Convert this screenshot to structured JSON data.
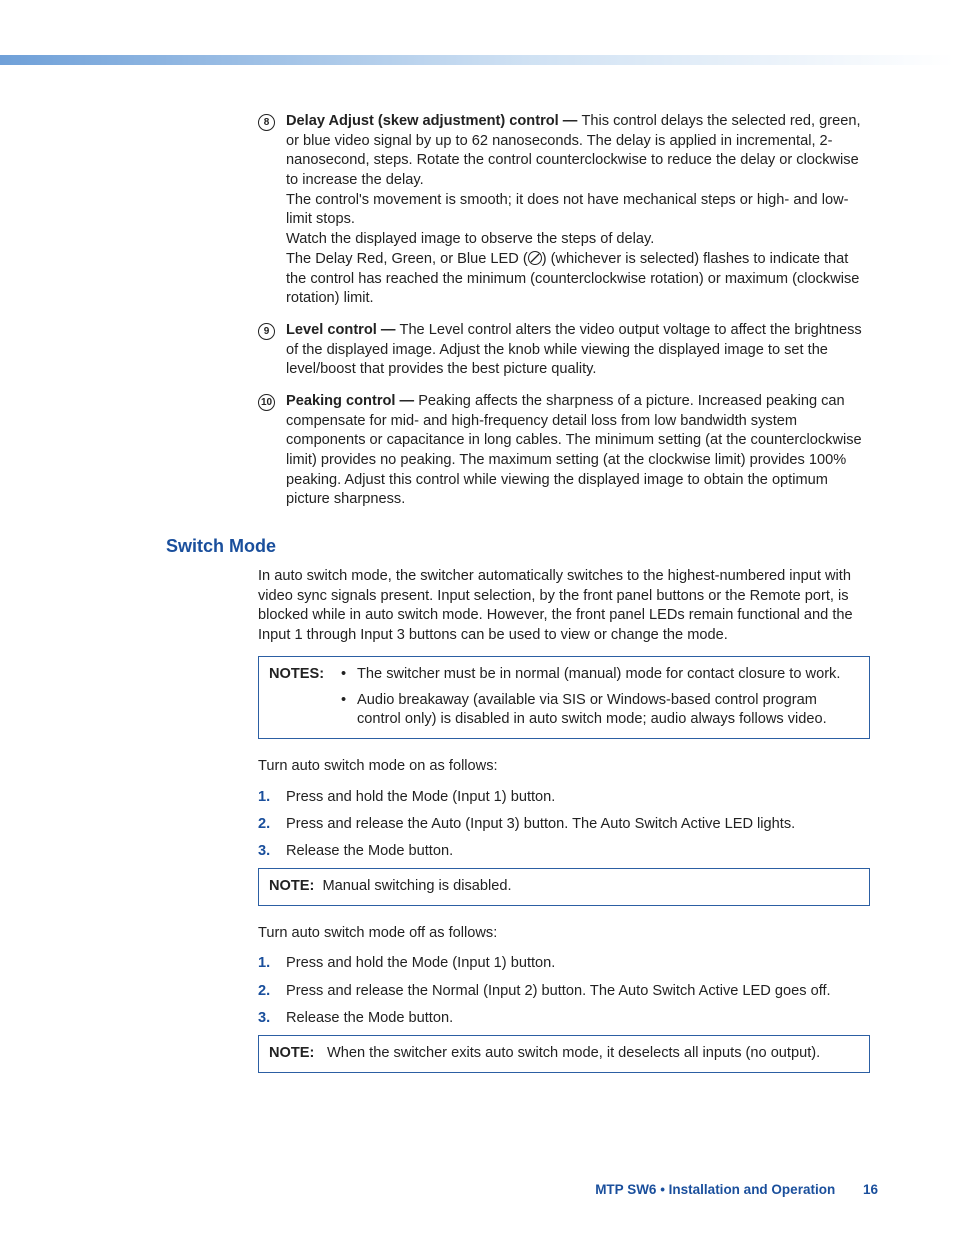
{
  "items": [
    {
      "num": "8",
      "title": "Delay Adjust (skew adjustment) control — ",
      "paras": [
        "This control delays the selected red, green, or blue video signal by up to 62 nanoseconds.  The delay is applied in incremental, 2-nanosecond, steps.  Rotate the control counterclockwise to reduce the delay or clockwise to increase the delay.",
        "The control's movement is smooth; it does not have mechanical steps or high- and low-limit stops.",
        "Watch the displayed image to observe the steps of delay.",
        "The Delay Red, Green, or Blue LED (⦸) (whichever is selected) flashes to indicate that the control has reached the minimum (counterclockwise rotation) or maximum (clockwise rotation) limit."
      ]
    },
    {
      "num": "9",
      "title": "Level control — ",
      "paras": [
        "The Level control alters the video output voltage to affect the brightness of the displayed image.  Adjust the knob while viewing the displayed image to set the level/boost that provides the best picture quality."
      ]
    },
    {
      "num": "10",
      "title": "Peaking control — ",
      "paras": [
        "Peaking affects the sharpness of a picture.  Increased peaking can compensate for mid- and high-frequency detail loss from low bandwidth system components or capacitance in long cables.  The minimum setting (at the counterclockwise limit) provides no peaking.  The maximum setting (at the clockwise limit) provides 100% peaking.  Adjust this control while viewing the displayed image to obtain the optimum picture sharpness."
      ]
    }
  ],
  "heading": "Switch Mode",
  "intro": "In auto switch mode, the switcher automatically switches to the highest-numbered input with video sync signals present.  Input selection, by the front panel buttons or the Remote port, is blocked while in auto switch mode.  However, the front panel LEDs remain functional and the Input 1 through Input 3 buttons can be used to view or change the mode.",
  "notes1": {
    "label": "NOTES:",
    "bullets": [
      "The switcher must be in normal (manual) mode for contact closure to work.",
      "Audio breakaway (available via SIS or Windows-based control program control only) is disabled in auto switch mode; audio always follows video."
    ]
  },
  "turnOnLead": "Turn auto switch mode on as follows:",
  "stepsOn": [
    "Press and hold the Mode (Input 1) button.",
    "Press and release the Auto (Input 3) button.  The Auto Switch Active LED lights.",
    "Release the Mode button."
  ],
  "note2": {
    "label": "NOTE:",
    "text": "Manual switching is disabled."
  },
  "turnOffLead": "Turn auto switch mode off as follows:",
  "stepsOff": [
    "Press and hold the Mode (Input 1) button.",
    "Press and release the Normal (Input 2) button.  The Auto Switch Active LED goes off.",
    "Release the Mode button."
  ],
  "note3": {
    "label": "NOTE:",
    "text": "When the switcher exits auto switch mode, it deselects all inputs (no output)."
  },
  "footer": {
    "text": "MTP SW6 • Installation and Operation",
    "page": "16"
  }
}
